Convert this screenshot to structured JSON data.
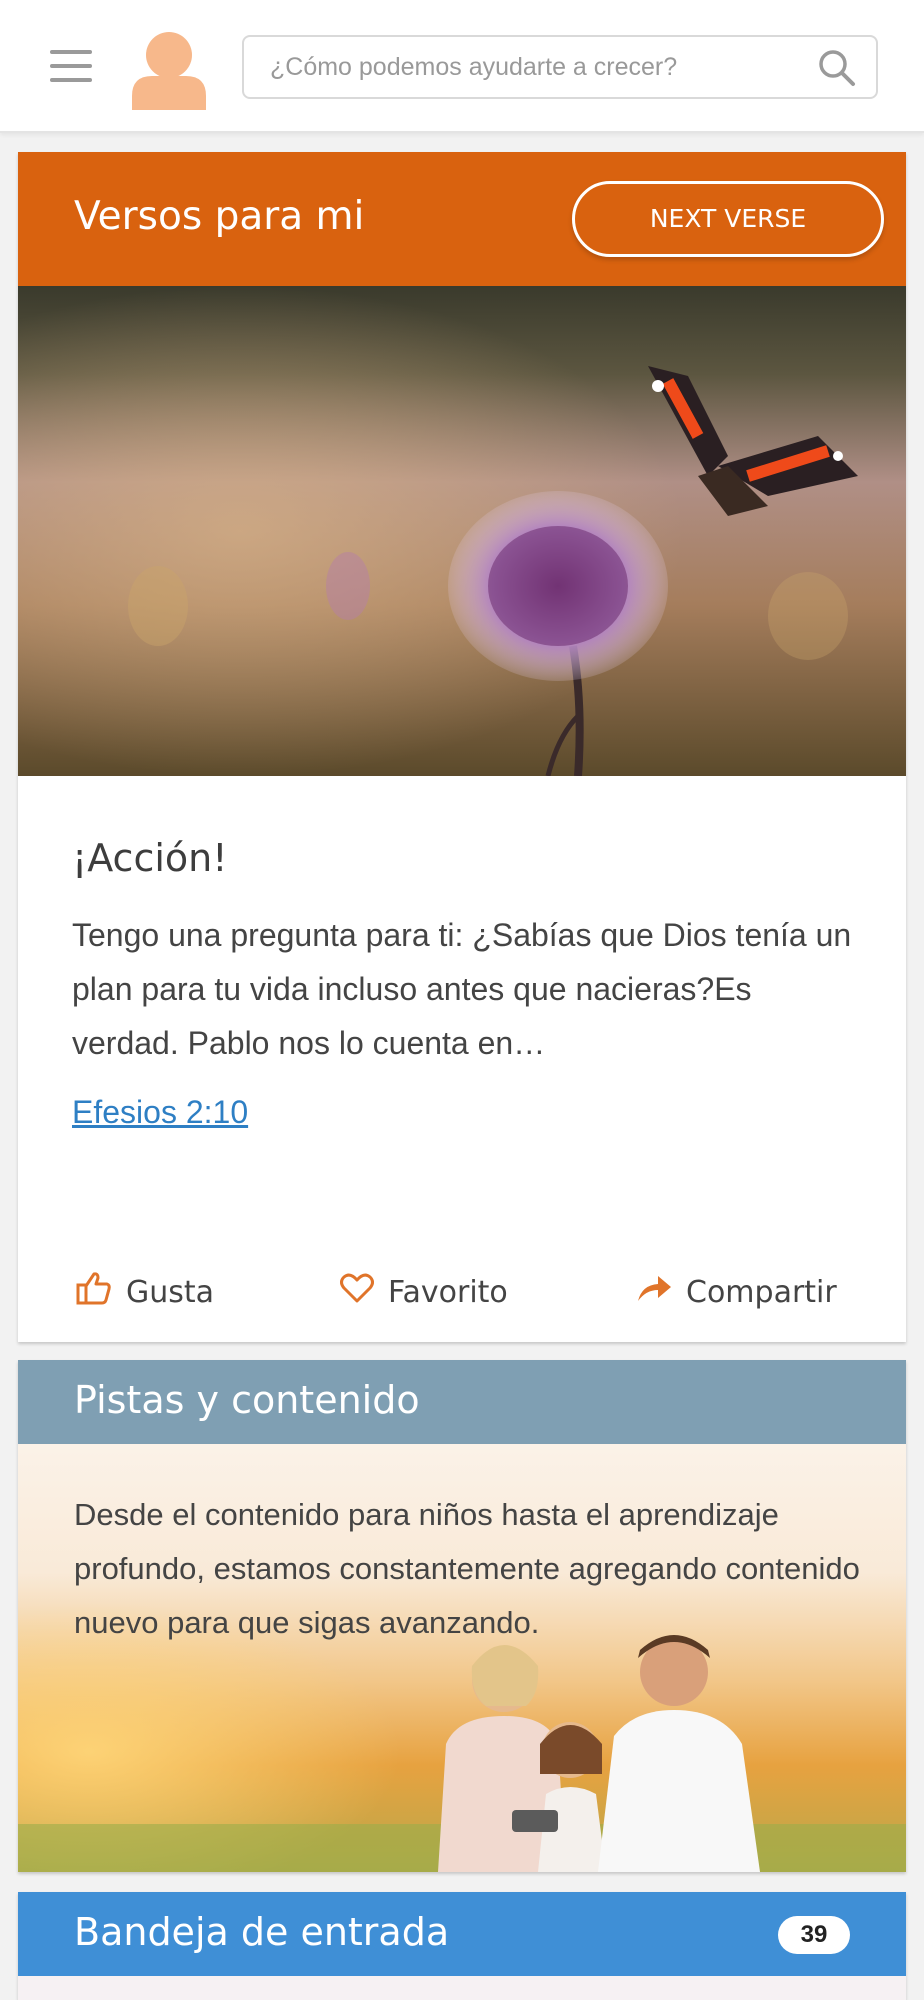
{
  "header": {
    "menu_icon": "hamburger-menu-icon",
    "avatar_icon": "user-avatar-icon",
    "search": {
      "placeholder": "¿Cómo podemos ayudarte a crecer?",
      "value": "",
      "icon": "search-icon"
    }
  },
  "verse_card": {
    "title": "Versos para mi",
    "next_button_label": "NEXT VERSE",
    "heading": "¡Acción!",
    "text": "Tengo una pregunta para ti: ¿Sabías que Dios tenía un plan para tu vida incluso antes que nacieras?Es verdad. Pablo nos lo cuenta en…",
    "reference": "Efesios 2:10",
    "actions": [
      {
        "label": "Gusta",
        "icon": "thumbs-up-icon"
      },
      {
        "label": "Favorito",
        "icon": "heart-icon"
      },
      {
        "label": "Compartir",
        "icon": "share-arrow-icon"
      }
    ]
  },
  "tracks_card": {
    "title": "Pistas y contenido",
    "text": "Desde el contenido para niños hasta el aprendizaje profundo, estamos constantemente agregando contenido nuevo para que sigas avanzando."
  },
  "inbox_card": {
    "title": "Bandeja de entrada",
    "badge": "39"
  },
  "colors": {
    "verse_header": "#d9620f",
    "tracks_header": "#7f9fb3",
    "inbox_header": "#3f8fd6",
    "link": "#2e7fc4",
    "accent_icon": "#e0742a"
  }
}
